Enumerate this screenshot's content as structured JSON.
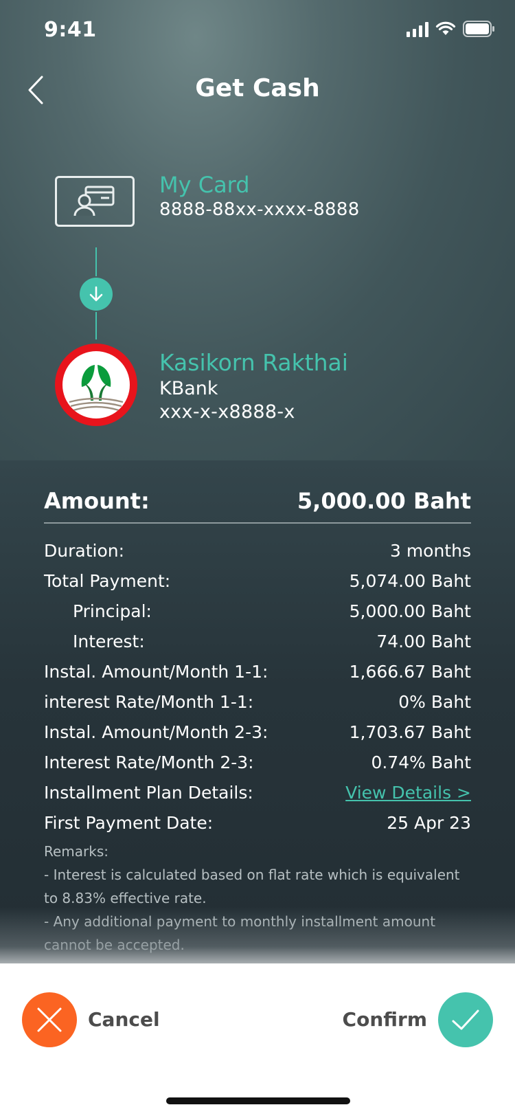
{
  "status_bar": {
    "time": "9:41"
  },
  "header": {
    "title": "Get Cash"
  },
  "source": {
    "title": "My Card",
    "card_number": "8888-88xx-xxxx-8888"
  },
  "destination": {
    "name": "Kasikorn Rakthai",
    "bank": "KBank",
    "account": "xxx-x-x8888-x"
  },
  "amount": {
    "label": "Amount:",
    "value": "5,000.00 Baht"
  },
  "details": [
    {
      "label": "Duration:",
      "value": "3 months"
    },
    {
      "label": "Total Payment:",
      "value": "5,074.00 Baht"
    },
    {
      "label": "Principal:",
      "value": "5,000.00 Baht"
    },
    {
      "label": "Interest:",
      "value": "74.00 Baht"
    },
    {
      "label": "Instal. Amount/Month 1-1:",
      "value": "1,666.67 Baht"
    },
    {
      "label": "interest Rate/Month 1-1:",
      "value": "0% Baht"
    },
    {
      "label": "Instal. Amount/Month 2-3:",
      "value": "1,703.67 Baht"
    },
    {
      "label": "Interest Rate/Month 2-3:",
      "value": "0.74% Baht"
    },
    {
      "label": "Installment Plan Details:",
      "value": "View Details >"
    },
    {
      "label": "First Payment Date:",
      "value": "25 Apr 23"
    }
  ],
  "remarks": {
    "title": "Remarks:",
    "items": [
      "- Interest is calculated based on flat rate which is equivalent to 8.83% effective rate.",
      "- Any additional payment to monthly installment amount cannot be accepted."
    ]
  },
  "actions": {
    "cancel_label": "Cancel",
    "confirm_label": "Confirm"
  },
  "colors": {
    "accent": "#45c3ad",
    "cancel": "#fb6422",
    "kbank_red": "#e8141c",
    "kbank_green": "#0a9c3c"
  },
  "icons": {
    "back": "chevron-left-icon",
    "card": "id-card-icon",
    "arrow": "arrow-down-icon",
    "cancel": "close-icon",
    "confirm": "check-icon"
  }
}
